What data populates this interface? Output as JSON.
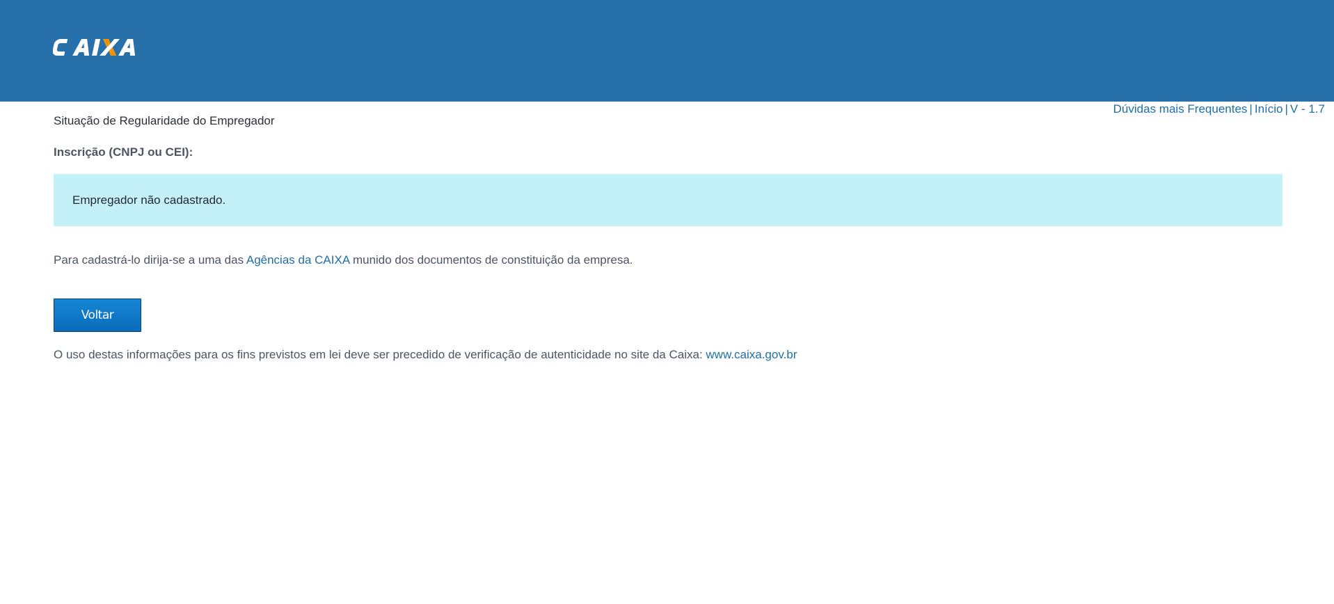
{
  "header": {
    "logo_text": "CAIXA",
    "brand_color": "#2770aa",
    "logo_accent_color": "#f39200"
  },
  "top_links": {
    "faq": "Dúvidas mais Frequentes",
    "separator": "|",
    "home": "Início",
    "version": "V - 1.7"
  },
  "main": {
    "title": "Situação de Regularidade do Empregador",
    "inscricao_label": "Inscrição (CNPJ ou CEI):",
    "alert_message": "Empregador não cadastrado.",
    "alert_bg_color": "#c4f0f8",
    "info_prefix": "Para cadastrá-lo dirija-se a uma das ",
    "info_link": "Agências da CAIXA",
    "info_suffix": " munido dos documentos de constituição da empresa.",
    "back_button": "Voltar",
    "footer_prefix": "O uso destas informações para os fins previstos em lei deve ser precedido de verificação de autenticidade no site da Caixa: ",
    "footer_link": "www.caixa.gov.br",
    "link_color": "#1f6fa6"
  }
}
